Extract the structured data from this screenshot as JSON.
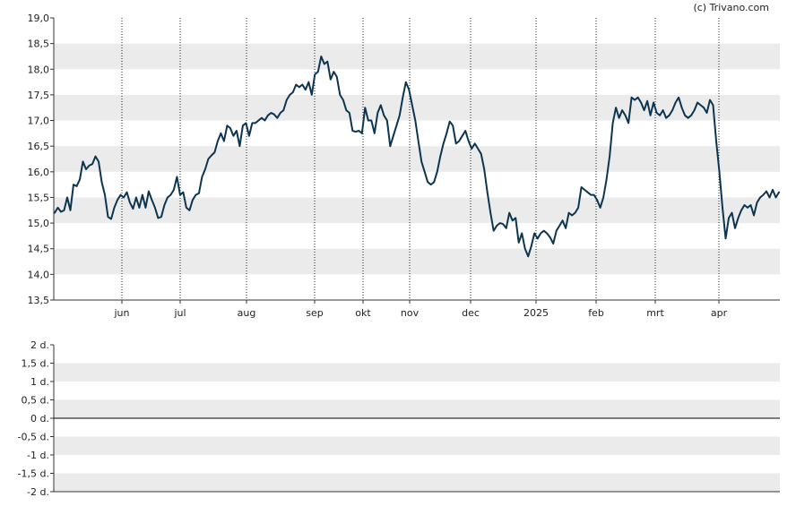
{
  "credit": "(c) Trivano.com",
  "colors": {
    "line": "#0d3550",
    "band": "#ebebeb",
    "axis": "#333333",
    "vline": "#222222"
  },
  "chart_data": [
    {
      "type": "line",
      "title": "",
      "xlabel": "",
      "ylabel": "",
      "ylim": [
        13.5,
        19.0
      ],
      "y_ticks": [
        "13,5",
        "14,0",
        "14,5",
        "15,0",
        "15,5",
        "16,0",
        "16,5",
        "17,0",
        "17,5",
        "18,0",
        "18,5",
        "19,0"
      ],
      "month_labels": [
        "jun",
        "jul",
        "aug",
        "sep",
        "okt",
        "nov",
        "dec",
        "2025",
        "feb",
        "mrt",
        "apr"
      ],
      "grid": "alternating horizontal bands, dotted vertical month lines",
      "series": [
        {
          "values": [
            15.2,
            15.3,
            15.22,
            15.25,
            15.5,
            15.25,
            15.75,
            15.72,
            15.85,
            16.2,
            16.05,
            16.12,
            16.15,
            16.3,
            16.2,
            15.8,
            15.55,
            15.12,
            15.08,
            15.3,
            15.45,
            15.55,
            15.5,
            15.6,
            15.4,
            15.28,
            15.5,
            15.3,
            15.55,
            15.3,
            15.62,
            15.45,
            15.3,
            15.1,
            15.12,
            15.35,
            15.5,
            15.55,
            15.65,
            15.9,
            15.55,
            15.6,
            15.3,
            15.25,
            15.45,
            15.55,
            15.58,
            15.9,
            16.05,
            16.25,
            16.32,
            16.38,
            16.6,
            16.75,
            16.6,
            16.9,
            16.85,
            16.7,
            16.8,
            16.5,
            16.9,
            16.95,
            16.7,
            16.95,
            16.95,
            17.0,
            17.05,
            17.0,
            17.1,
            17.15,
            17.12,
            17.05,
            17.15,
            17.2,
            17.4,
            17.5,
            17.55,
            17.7,
            17.65,
            17.7,
            17.6,
            17.75,
            17.5,
            17.9,
            17.95,
            18.25,
            18.1,
            18.15,
            17.8,
            17.95,
            17.85,
            17.5,
            17.4,
            17.2,
            17.15,
            16.8,
            16.78,
            16.8,
            16.75,
            17.25,
            17.0,
            17.0,
            16.75,
            17.15,
            17.3,
            17.1,
            17.0,
            16.5,
            16.7,
            16.9,
            17.1,
            17.45,
            17.75,
            17.6,
            17.3,
            17.0,
            16.6,
            16.2,
            16.0,
            15.8,
            15.75,
            15.8,
            16.0,
            16.3,
            16.55,
            16.75,
            16.98,
            16.9,
            16.55,
            16.6,
            16.7,
            16.8,
            16.6,
            16.45,
            16.55,
            16.45,
            16.35,
            16.05,
            15.6,
            15.2,
            14.85,
            14.95,
            15.0,
            14.98,
            14.9,
            15.2,
            15.05,
            15.1,
            14.62,
            14.8,
            14.5,
            14.35,
            14.55,
            14.8,
            14.7,
            14.8,
            14.85,
            14.8,
            14.72,
            14.6,
            14.85,
            14.95,
            15.05,
            14.9,
            15.2,
            15.15,
            15.2,
            15.3,
            15.7,
            15.65,
            15.6,
            15.55,
            15.55,
            15.45,
            15.3,
            15.5,
            15.85,
            16.3,
            16.95,
            17.25,
            17.05,
            17.2,
            17.1,
            16.95,
            17.45,
            17.4,
            17.45,
            17.35,
            17.2,
            17.38,
            17.1,
            17.35,
            17.15,
            17.1,
            17.2,
            17.05,
            17.1,
            17.2,
            17.35,
            17.45,
            17.25,
            17.1,
            17.05,
            17.1,
            17.2,
            17.35,
            17.3,
            17.25,
            17.15,
            17.4,
            17.3,
            16.6,
            16.0,
            15.3,
            14.7,
            15.1,
            15.2,
            14.9,
            15.1,
            15.25,
            15.35,
            15.3,
            15.35,
            15.15,
            15.4,
            15.5,
            15.55,
            15.62,
            15.5,
            15.65,
            15.5,
            15.6
          ]
        }
      ]
    },
    {
      "type": "line",
      "title": "",
      "xlabel": "",
      "ylabel": "",
      "ylim": [
        -2,
        2
      ],
      "y_ticks": [
        "-2 d.",
        "-1,5 d.",
        "-1 d.",
        "-0,5 d.",
        "0 d.",
        "0,5 d.",
        "1 d.",
        "1,5 d.",
        "2 d."
      ],
      "grid": "alternating horizontal bands, solid zero line",
      "series": []
    }
  ]
}
